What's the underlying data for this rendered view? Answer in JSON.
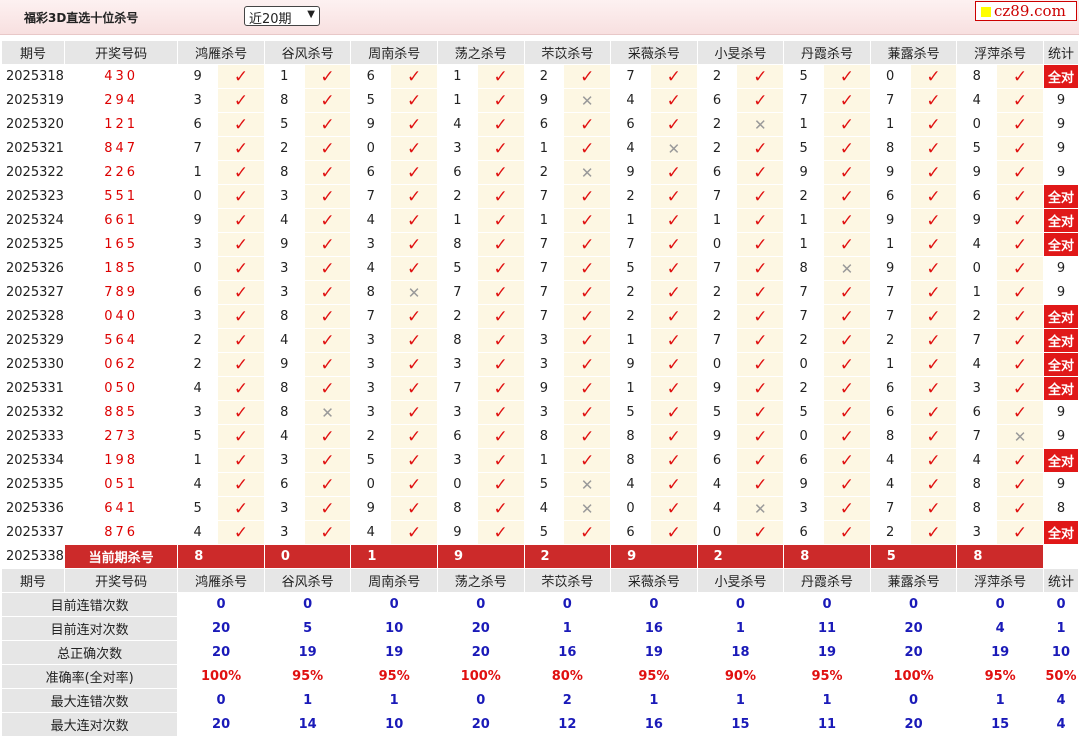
{
  "header": {
    "title": "福彩3D直选十位杀号",
    "period_select": "近20期",
    "logo": "cz89.com"
  },
  "columns": {
    "period": "期号",
    "draw": "开奖号码",
    "experts": [
      "鸿雁杀号",
      "谷风杀号",
      "周南杀号",
      "荡之杀号",
      "芣苡杀号",
      "采薇杀号",
      "小旻杀号",
      "丹霞杀号",
      "蒹露杀号",
      "浮萍杀号"
    ],
    "stat": "统计"
  },
  "rows": [
    {
      "p": "2025318",
      "n": "430",
      "k": [
        [
          "9",
          1
        ],
        [
          "1",
          1
        ],
        [
          "6",
          1
        ],
        [
          "1",
          1
        ],
        [
          "2",
          1
        ],
        [
          "7",
          1
        ],
        [
          "2",
          1
        ],
        [
          "5",
          1
        ],
        [
          "0",
          1
        ],
        [
          "8",
          1
        ]
      ],
      "s": "全对",
      "all": true
    },
    {
      "p": "2025319",
      "n": "294",
      "k": [
        [
          "3",
          1
        ],
        [
          "8",
          1
        ],
        [
          "5",
          1
        ],
        [
          "1",
          1
        ],
        [
          "9",
          0
        ],
        [
          "4",
          1
        ],
        [
          "6",
          1
        ],
        [
          "7",
          1
        ],
        [
          "7",
          1
        ],
        [
          "4",
          1
        ]
      ],
      "s": "9",
      "all": false
    },
    {
      "p": "2025320",
      "n": "121",
      "k": [
        [
          "6",
          1
        ],
        [
          "5",
          1
        ],
        [
          "9",
          1
        ],
        [
          "4",
          1
        ],
        [
          "6",
          1
        ],
        [
          "6",
          1
        ],
        [
          "2",
          0
        ],
        [
          "1",
          1
        ],
        [
          "1",
          1
        ],
        [
          "0",
          1
        ]
      ],
      "s": "9",
      "all": false
    },
    {
      "p": "2025321",
      "n": "847",
      "k": [
        [
          "7",
          1
        ],
        [
          "2",
          1
        ],
        [
          "0",
          1
        ],
        [
          "3",
          1
        ],
        [
          "1",
          1
        ],
        [
          "4",
          0
        ],
        [
          "2",
          1
        ],
        [
          "5",
          1
        ],
        [
          "8",
          1
        ],
        [
          "5",
          1
        ]
      ],
      "s": "9",
      "all": false
    },
    {
      "p": "2025322",
      "n": "226",
      "k": [
        [
          "1",
          1
        ],
        [
          "8",
          1
        ],
        [
          "6",
          1
        ],
        [
          "6",
          1
        ],
        [
          "2",
          0
        ],
        [
          "9",
          1
        ],
        [
          "6",
          1
        ],
        [
          "9",
          1
        ],
        [
          "9",
          1
        ],
        [
          "9",
          1
        ]
      ],
      "s": "9",
      "all": false
    },
    {
      "p": "2025323",
      "n": "551",
      "k": [
        [
          "0",
          1
        ],
        [
          "3",
          1
        ],
        [
          "7",
          1
        ],
        [
          "2",
          1
        ],
        [
          "7",
          1
        ],
        [
          "2",
          1
        ],
        [
          "7",
          1
        ],
        [
          "2",
          1
        ],
        [
          "6",
          1
        ],
        [
          "6",
          1
        ]
      ],
      "s": "全对",
      "all": true
    },
    {
      "p": "2025324",
      "n": "661",
      "k": [
        [
          "9",
          1
        ],
        [
          "4",
          1
        ],
        [
          "4",
          1
        ],
        [
          "1",
          1
        ],
        [
          "1",
          1
        ],
        [
          "1",
          1
        ],
        [
          "1",
          1
        ],
        [
          "1",
          1
        ],
        [
          "9",
          1
        ],
        [
          "9",
          1
        ]
      ],
      "s": "全对",
      "all": true
    },
    {
      "p": "2025325",
      "n": "165",
      "k": [
        [
          "3",
          1
        ],
        [
          "9",
          1
        ],
        [
          "3",
          1
        ],
        [
          "8",
          1
        ],
        [
          "7",
          1
        ],
        [
          "7",
          1
        ],
        [
          "0",
          1
        ],
        [
          "1",
          1
        ],
        [
          "1",
          1
        ],
        [
          "4",
          1
        ]
      ],
      "s": "全对",
      "all": true
    },
    {
      "p": "2025326",
      "n": "185",
      "k": [
        [
          "0",
          1
        ],
        [
          "3",
          1
        ],
        [
          "4",
          1
        ],
        [
          "5",
          1
        ],
        [
          "7",
          1
        ],
        [
          "5",
          1
        ],
        [
          "7",
          1
        ],
        [
          "8",
          0
        ],
        [
          "9",
          1
        ],
        [
          "0",
          1
        ]
      ],
      "s": "9",
      "all": false
    },
    {
      "p": "2025327",
      "n": "789",
      "k": [
        [
          "6",
          1
        ],
        [
          "3",
          1
        ],
        [
          "8",
          0
        ],
        [
          "7",
          1
        ],
        [
          "7",
          1
        ],
        [
          "2",
          1
        ],
        [
          "2",
          1
        ],
        [
          "7",
          1
        ],
        [
          "7",
          1
        ],
        [
          "1",
          1
        ]
      ],
      "s": "9",
      "all": false
    },
    {
      "p": "2025328",
      "n": "040",
      "k": [
        [
          "3",
          1
        ],
        [
          "8",
          1
        ],
        [
          "7",
          1
        ],
        [
          "2",
          1
        ],
        [
          "7",
          1
        ],
        [
          "2",
          1
        ],
        [
          "2",
          1
        ],
        [
          "7",
          1
        ],
        [
          "7",
          1
        ],
        [
          "2",
          1
        ]
      ],
      "s": "全对",
      "all": true
    },
    {
      "p": "2025329",
      "n": "564",
      "k": [
        [
          "2",
          1
        ],
        [
          "4",
          1
        ],
        [
          "3",
          1
        ],
        [
          "8",
          1
        ],
        [
          "3",
          1
        ],
        [
          "1",
          1
        ],
        [
          "7",
          1
        ],
        [
          "2",
          1
        ],
        [
          "2",
          1
        ],
        [
          "7",
          1
        ]
      ],
      "s": "全对",
      "all": true
    },
    {
      "p": "2025330",
      "n": "062",
      "k": [
        [
          "2",
          1
        ],
        [
          "9",
          1
        ],
        [
          "3",
          1
        ],
        [
          "3",
          1
        ],
        [
          "3",
          1
        ],
        [
          "9",
          1
        ],
        [
          "0",
          1
        ],
        [
          "0",
          1
        ],
        [
          "1",
          1
        ],
        [
          "4",
          1
        ]
      ],
      "s": "全对",
      "all": true
    },
    {
      "p": "2025331",
      "n": "050",
      "k": [
        [
          "4",
          1
        ],
        [
          "8",
          1
        ],
        [
          "3",
          1
        ],
        [
          "7",
          1
        ],
        [
          "9",
          1
        ],
        [
          "1",
          1
        ],
        [
          "9",
          1
        ],
        [
          "2",
          1
        ],
        [
          "6",
          1
        ],
        [
          "3",
          1
        ]
      ],
      "s": "全对",
      "all": true
    },
    {
      "p": "2025332",
      "n": "885",
      "k": [
        [
          "3",
          1
        ],
        [
          "8",
          0
        ],
        [
          "3",
          1
        ],
        [
          "3",
          1
        ],
        [
          "3",
          1
        ],
        [
          "5",
          1
        ],
        [
          "5",
          1
        ],
        [
          "5",
          1
        ],
        [
          "6",
          1
        ],
        [
          "6",
          1
        ]
      ],
      "s": "9",
      "all": false
    },
    {
      "p": "2025333",
      "n": "273",
      "k": [
        [
          "5",
          1
        ],
        [
          "4",
          1
        ],
        [
          "2",
          1
        ],
        [
          "6",
          1
        ],
        [
          "8",
          1
        ],
        [
          "8",
          1
        ],
        [
          "9",
          1
        ],
        [
          "0",
          1
        ],
        [
          "8",
          1
        ],
        [
          "7",
          0
        ]
      ],
      "s": "9",
      "all": false
    },
    {
      "p": "2025334",
      "n": "198",
      "k": [
        [
          "1",
          1
        ],
        [
          "3",
          1
        ],
        [
          "5",
          1
        ],
        [
          "3",
          1
        ],
        [
          "1",
          1
        ],
        [
          "8",
          1
        ],
        [
          "6",
          1
        ],
        [
          "6",
          1
        ],
        [
          "4",
          1
        ],
        [
          "4",
          1
        ]
      ],
      "s": "全对",
      "all": true
    },
    {
      "p": "2025335",
      "n": "051",
      "k": [
        [
          "4",
          1
        ],
        [
          "6",
          1
        ],
        [
          "0",
          1
        ],
        [
          "0",
          1
        ],
        [
          "5",
          0
        ],
        [
          "4",
          1
        ],
        [
          "4",
          1
        ],
        [
          "9",
          1
        ],
        [
          "4",
          1
        ],
        [
          "8",
          1
        ]
      ],
      "s": "9",
      "all": false
    },
    {
      "p": "2025336",
      "n": "641",
      "k": [
        [
          "5",
          1
        ],
        [
          "3",
          1
        ],
        [
          "9",
          1
        ],
        [
          "8",
          1
        ],
        [
          "4",
          0
        ],
        [
          "0",
          1
        ],
        [
          "4",
          0
        ],
        [
          "3",
          1
        ],
        [
          "7",
          1
        ],
        [
          "8",
          1
        ]
      ],
      "s": "8",
      "all": false
    },
    {
      "p": "2025337",
      "n": "876",
      "k": [
        [
          "4",
          1
        ],
        [
          "3",
          1
        ],
        [
          "4",
          1
        ],
        [
          "9",
          1
        ],
        [
          "5",
          1
        ],
        [
          "6",
          1
        ],
        [
          "0",
          1
        ],
        [
          "6",
          1
        ],
        [
          "2",
          1
        ],
        [
          "3",
          1
        ]
      ],
      "s": "全对",
      "all": true
    }
  ],
  "current": {
    "p": "2025338",
    "label": "当前期杀号",
    "kills": [
      "8",
      "0",
      "1",
      "9",
      "2",
      "9",
      "2",
      "8",
      "5",
      "8"
    ]
  },
  "stats": [
    {
      "label": "目前连错次数",
      "vals": [
        "0",
        "0",
        "0",
        "0",
        "0",
        "0",
        "0",
        "0",
        "0",
        "0"
      ],
      "total": "0",
      "red": false
    },
    {
      "label": "目前连对次数",
      "vals": [
        "20",
        "5",
        "10",
        "20",
        "1",
        "16",
        "1",
        "11",
        "20",
        "4"
      ],
      "total": "1",
      "red": false
    },
    {
      "label": "总正确次数",
      "vals": [
        "20",
        "19",
        "19",
        "20",
        "16",
        "19",
        "18",
        "19",
        "20",
        "19"
      ],
      "total": "10",
      "red": false
    },
    {
      "label": "准确率(全对率)",
      "vals": [
        "100%",
        "95%",
        "95%",
        "100%",
        "80%",
        "95%",
        "90%",
        "95%",
        "100%",
        "95%"
      ],
      "total": "50%",
      "red": true
    },
    {
      "label": "最大连错次数",
      "vals": [
        "0",
        "1",
        "1",
        "0",
        "2",
        "1",
        "1",
        "1",
        "0",
        "1"
      ],
      "total": "4",
      "red": false
    },
    {
      "label": "最大连对次数",
      "vals": [
        "20",
        "14",
        "10",
        "20",
        "12",
        "16",
        "15",
        "11",
        "20",
        "15"
      ],
      "total": "4",
      "red": false
    }
  ],
  "marks": {
    "ok": "✓",
    "no": "✕"
  },
  "colors": {
    "check": "#e01212",
    "all_correct": "#e01818",
    "current_row": "#cc2a2a",
    "stat_blue": "#1a1ab8",
    "header_bg": "#e6e6e6"
  }
}
